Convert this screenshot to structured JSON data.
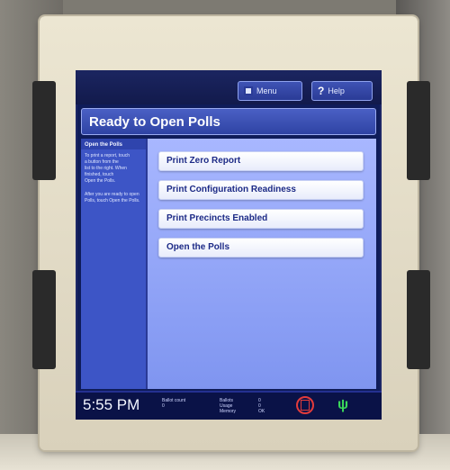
{
  "topbar": {
    "menu_label": "Menu",
    "help_label": "Help"
  },
  "title": "Ready to Open Polls",
  "sidebar": {
    "heading": "Open the Polls",
    "lines": [
      "To print a report, touch",
      "a button from the",
      "list to the right. When",
      "finished, touch",
      "Open the Polls."
    ],
    "extra": "After you are ready to open Polls, touch Open the Polls."
  },
  "actions": [
    {
      "label": "Print Zero Report"
    },
    {
      "label": "Print Configuration Readiness"
    },
    {
      "label": "Print Precincts Enabled"
    },
    {
      "label": "Open the Polls"
    }
  ],
  "status": {
    "time": "5:55 PM",
    "block1": [
      "Ballot count",
      "0"
    ],
    "block2": [
      "Ballots",
      "Usage",
      "Memory"
    ],
    "block3": [
      "0",
      "0",
      "OK"
    ]
  },
  "icons": {
    "menu": "menu-icon",
    "help": "help-icon",
    "alert": "alert-icon",
    "power": "power-plug-icon"
  },
  "colors": {
    "screen_bg": "#0f1c59",
    "title_bar": "#2f43a4",
    "content_bg": "#8ea2f5",
    "button_text": "#1c2a86",
    "alert": "#e23b3b",
    "plug": "#3ad85a"
  }
}
